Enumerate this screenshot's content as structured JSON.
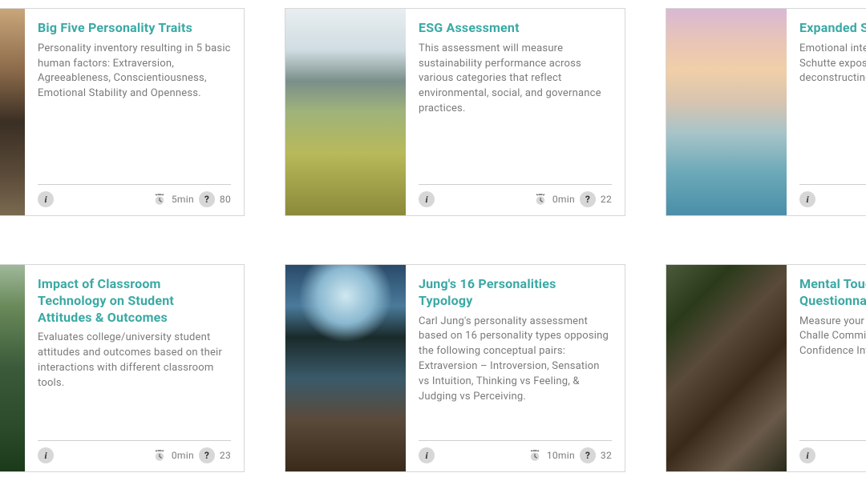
{
  "rows": [
    [
      {
        "imageClass": "img-mountain-sunset",
        "title": "Big Five Personality Traits",
        "description": "Personality inventory resulting in 5 basic human factors: Extraversion, Agreeableness, Conscientiousness, Emotional Stability and Openness.",
        "duration": "5min",
        "questions": "80"
      },
      {
        "imageClass": "img-rice-field",
        "title": "ESG Assessment",
        "description": "This assessment will measure sustainability performance across various categories that reflect environmental, social, and governance practices.",
        "duration": "0min",
        "questions": "22"
      },
      {
        "imageClass": "img-gradient-sunset",
        "title": "Expanded Schutte EI Test",
        "description": "Emotional intelligence on the work of Schutte exposing a primary E deconstructing it into subdimensions.",
        "duration": "",
        "questions": ""
      }
    ],
    [
      {
        "imageClass": "img-forest",
        "title": "Impact of Classroom Technology on Student Attitudes & Outcomes",
        "description": "Evaluates college/university student attitudes and outcomes based on their interactions with different classroom tools.",
        "duration": "0min",
        "questions": "23"
      },
      {
        "imageClass": "img-dock-lake",
        "title": "Jung's 16 Personalities Typology",
        "description": "Carl Jung's personality assessment based on 16 personality types opposing the following conceptual pairs: Extraversion – Introversion, Sensation vs Intuition, Thinking vs Feeling, & Judging vs Perceiving.",
        "duration": "10min",
        "questions": "32"
      },
      {
        "imageClass": "img-tree-roots",
        "title": "Mental Toughness Questionnaire (M",
        "description": "Measure your mental describes it as Challe Commitment, Contro Life), and Confidence Interpersonal).",
        "duration": "",
        "questions": ""
      }
    ]
  ]
}
